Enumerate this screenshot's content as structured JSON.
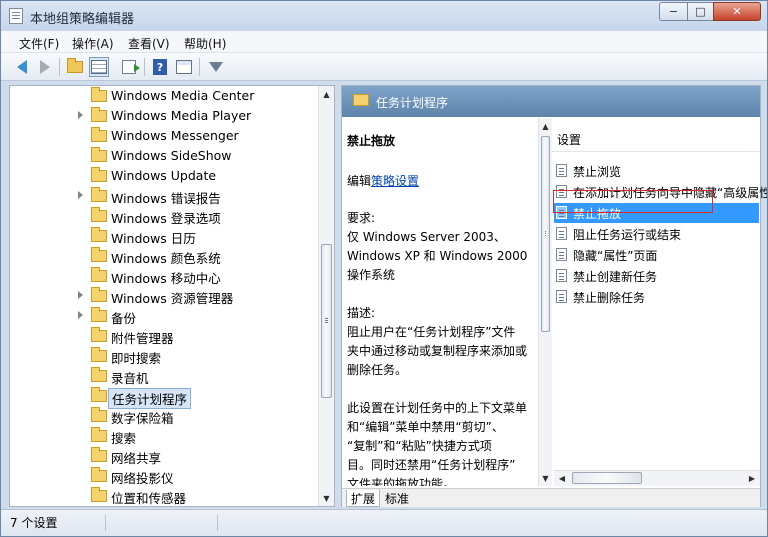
{
  "window": {
    "title": "本地组策略编辑器",
    "min_glyph": "−",
    "max_glyph": "□",
    "close_glyph": "✕"
  },
  "menu": [
    "文件(F)",
    "操作(A)",
    "查看(V)",
    "帮助(H)"
  ],
  "tree": [
    {
      "label": "Windows Media Center",
      "expandable": false,
      "selected": false
    },
    {
      "label": "Windows Media Player",
      "expandable": true,
      "selected": false
    },
    {
      "label": "Windows Messenger",
      "expandable": false,
      "selected": false
    },
    {
      "label": "Windows SideShow",
      "expandable": false,
      "selected": false
    },
    {
      "label": "Windows Update",
      "expandable": false,
      "selected": false
    },
    {
      "label": "Windows 错误报告",
      "expandable": true,
      "selected": false
    },
    {
      "label": "Windows 登录选项",
      "expandable": false,
      "selected": false
    },
    {
      "label": "Windows 日历",
      "expandable": false,
      "selected": false
    },
    {
      "label": "Windows 颜色系统",
      "expandable": false,
      "selected": false
    },
    {
      "label": "Windows 移动中心",
      "expandable": false,
      "selected": false
    },
    {
      "label": "Windows 资源管理器",
      "expandable": true,
      "selected": false
    },
    {
      "label": "备份",
      "expandable": true,
      "selected": false
    },
    {
      "label": "附件管理器",
      "expandable": false,
      "selected": false
    },
    {
      "label": "即时搜索",
      "expandable": false,
      "selected": false
    },
    {
      "label": "录音机",
      "expandable": false,
      "selected": false
    },
    {
      "label": "任务计划程序",
      "expandable": false,
      "selected": true
    },
    {
      "label": "数字保险箱",
      "expandable": false,
      "selected": false
    },
    {
      "label": "搜索",
      "expandable": false,
      "selected": false
    },
    {
      "label": "网络共享",
      "expandable": false,
      "selected": false
    },
    {
      "label": "网络投影仪",
      "expandable": false,
      "selected": false
    },
    {
      "label": "位置和传感器",
      "expandable": false,
      "selected": false
    }
  ],
  "right": {
    "header": "任务计划程序",
    "desc": {
      "title": "禁止拖放",
      "edit_prefix": "编辑",
      "edit_link": "策略设置",
      "req_label": "要求:",
      "req_lines": [
        "仅 Windows Server 2003、",
        "Windows XP 和 Windows 2000",
        "操作系统"
      ],
      "desc_label": "描述:",
      "desc_lines": [
        "阻止用户在“任务计划程序”文件",
        "夹中通过移动或复制程序来添加或",
        "删除任务。"
      ],
      "extra_lines": [
        "此设置在计划任务中的上下文菜单",
        "和“编辑”菜单中禁用“剪切”、",
        "“复制”和“粘贴”快捷方式项",
        "目。同时还禁用“任务计划程序”",
        "文件夹的拖放功能。"
      ]
    },
    "settings_header": "设置",
    "settings": [
      {
        "label": "禁止浏览",
        "selected": false
      },
      {
        "label": "在添加计划任务向导中隐藏“高级属性”",
        "selected": false
      },
      {
        "label": "禁止拖放",
        "selected": true
      },
      {
        "label": "阻止任务运行或结束",
        "selected": false
      },
      {
        "label": "隐藏“属性”页面",
        "selected": false
      },
      {
        "label": "禁止创建新任务",
        "selected": false
      },
      {
        "label": "禁止删除任务",
        "selected": false
      }
    ],
    "tabs": [
      "扩展",
      "标准"
    ]
  },
  "status": "7 个设置",
  "toolbar": {
    "help_glyph": "?"
  },
  "scroll": {
    "up_glyph": "▲",
    "down_glyph": "▼",
    "left_glyph": "◀",
    "right_glyph": "▶"
  },
  "colors": {
    "selection": "#3399ff",
    "header": "#6a8fb4",
    "highlight_box": "#e02828",
    "link": "#0645ad"
  }
}
